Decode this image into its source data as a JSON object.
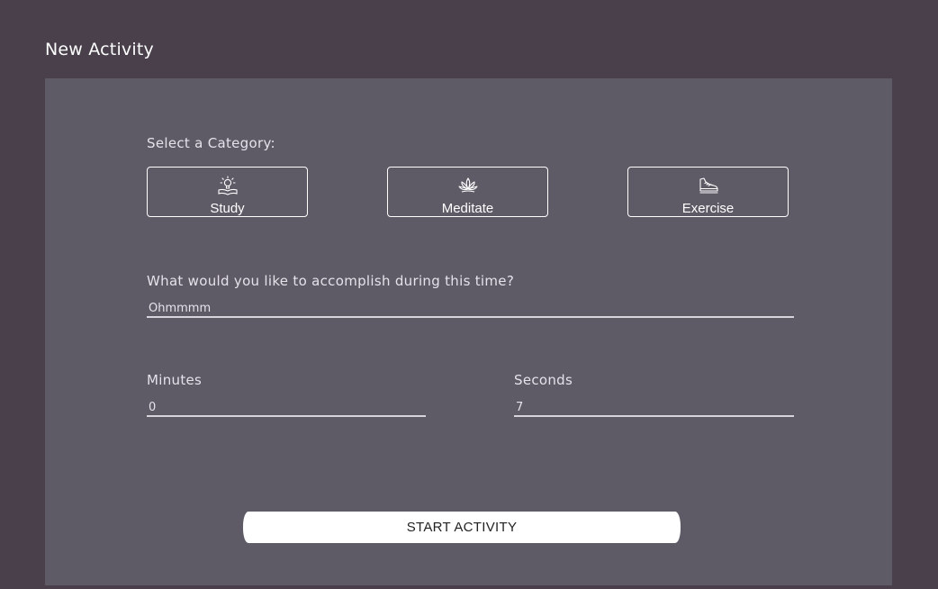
{
  "header": {
    "title": "New Activity"
  },
  "form": {
    "category_label": "Select a Category:",
    "categories": [
      {
        "label": "Study",
        "icon": "lightbulb-book-icon"
      },
      {
        "label": "Meditate",
        "icon": "lotus-icon"
      },
      {
        "label": "Exercise",
        "icon": "sneaker-icon"
      }
    ],
    "goal_label": "What would you like to accomplish during this time?",
    "goal_value": "Ohmmmm",
    "minutes_label": "Minutes",
    "minutes_value": "0",
    "seconds_label": "Seconds",
    "seconds_value": "7",
    "submit_label": "START ACTIVITY"
  },
  "colors": {
    "background": "#49404c",
    "panel": "#5e5a66",
    "button": "#ffffff"
  }
}
